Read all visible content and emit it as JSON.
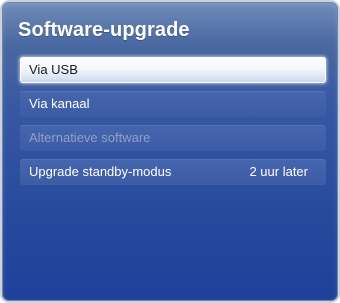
{
  "menu": {
    "title": "Software-upgrade",
    "items": [
      {
        "label": "Via USB",
        "state": "selected"
      },
      {
        "label": "Via kanaal",
        "state": "normal"
      },
      {
        "label": "Alternatieve software",
        "state": "disabled"
      },
      {
        "label": "Upgrade standby-modus",
        "value": "2 uur later",
        "state": "normal"
      }
    ]
  },
  "colors": {
    "panel_top": "#6f8cb9",
    "panel_bottom": "#1f4099",
    "item_bg": "#4565ad",
    "selected_bg": "#ffffff",
    "disabled_text": "#8ea1c8"
  }
}
